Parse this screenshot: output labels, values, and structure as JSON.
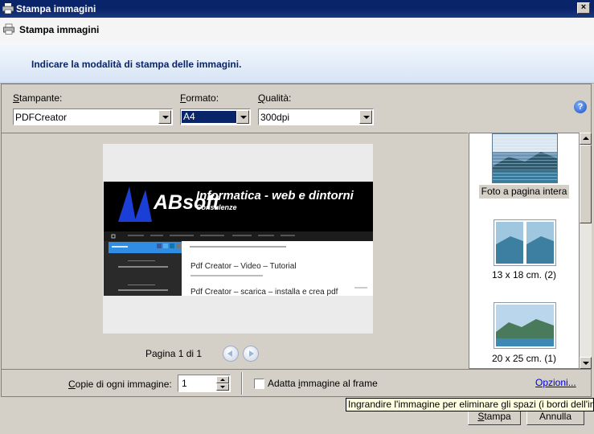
{
  "window": {
    "title": "Stampa immagini",
    "close_glyph": "×"
  },
  "header": {
    "title": "Stampa immagini",
    "subtitle": "Indicare la modalità di stampa delle immagini."
  },
  "printer": {
    "label_first": "S",
    "label_rest": "tampante:",
    "value": "PDFCreator"
  },
  "format": {
    "label_first": "F",
    "label_rest": "ormato:",
    "value": "A4"
  },
  "quality": {
    "label_first": "Q",
    "label_rest": "ualità:",
    "value": "300dpi"
  },
  "help_glyph": "?",
  "preview": {
    "page_status": "Pagina 1 di 1",
    "image": {
      "logo": "ABsoft",
      "headline": "Informatica - web e dintorni",
      "tagline": "Consulenze",
      "post1": "Pdf Creator – Video – Tutorial",
      "post2": "Pdf Creator – scarica – installa e crea pdf"
    }
  },
  "layouts": [
    {
      "label": "Foto a pagina intera",
      "selected": true
    },
    {
      "label": "13 x 18 cm. (2)",
      "selected": false
    },
    {
      "label": "20 x 25 cm. (1)",
      "selected": false
    }
  ],
  "copies": {
    "label_a": "C",
    "label_b": "opie di ogni immagine:",
    "value": "1"
  },
  "fit": {
    "label_a": "Adatta ",
    "label_b": "i",
    "label_c": "mmagine al frame",
    "checked": false
  },
  "options_link": "Opzioni...",
  "buttons": {
    "print_a": "S",
    "print_b": "tampa",
    "cancel": "Annulla"
  },
  "tooltip": "Ingrandire l'immagine per eliminare gli spazi (i bordi dell'immagine"
}
